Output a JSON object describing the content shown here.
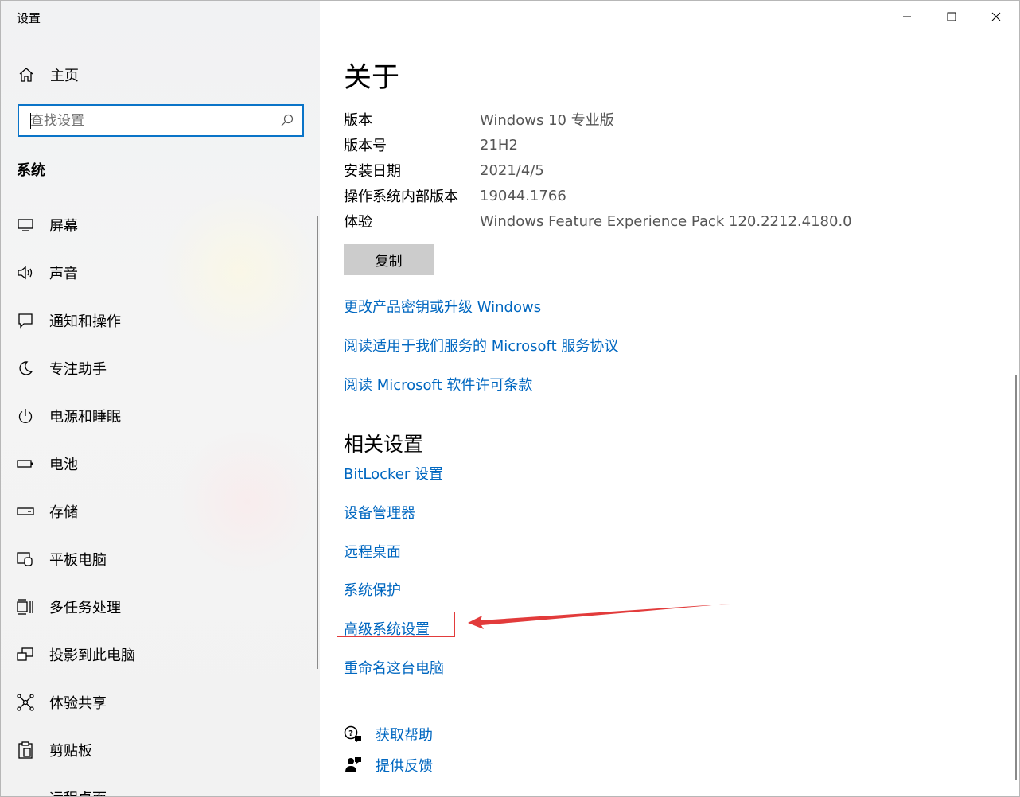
{
  "window": {
    "title": "设置"
  },
  "sidebar": {
    "home_label": "主页",
    "search_placeholder": "查找设置",
    "section_title": "系统",
    "items": [
      {
        "label": "屏幕",
        "icon": "monitor-icon"
      },
      {
        "label": "声音",
        "icon": "speaker-icon"
      },
      {
        "label": "通知和操作",
        "icon": "notification-icon"
      },
      {
        "label": "专注助手",
        "icon": "moon-icon"
      },
      {
        "label": "电源和睡眠",
        "icon": "power-icon"
      },
      {
        "label": "电池",
        "icon": "battery-icon"
      },
      {
        "label": "存储",
        "icon": "storage-icon"
      },
      {
        "label": "平板电脑",
        "icon": "tablet-icon"
      },
      {
        "label": "多任务处理",
        "icon": "multitask-icon"
      },
      {
        "label": "投影到此电脑",
        "icon": "project-icon"
      },
      {
        "label": "体验共享",
        "icon": "share-icon"
      },
      {
        "label": "剪贴板",
        "icon": "clipboard-icon"
      },
      {
        "label": "远程桌面",
        "icon": "remote-icon"
      }
    ]
  },
  "main": {
    "title": "关于",
    "specs": [
      {
        "key": "版本",
        "value": "Windows 10 专业版"
      },
      {
        "key": "版本号",
        "value": "21H2"
      },
      {
        "key": "安装日期",
        "value": "2021/4/5"
      },
      {
        "key": "操作系统内部版本",
        "value": "19044.1766"
      },
      {
        "key": "体验",
        "value": "Windows Feature Experience Pack 120.2212.4180.0"
      }
    ],
    "copy_label": "复制",
    "links": [
      "更改产品密钥或升级 Windows",
      "阅读适用于我们服务的 Microsoft 服务协议",
      "阅读 Microsoft 软件许可条款"
    ],
    "related_title": "相关设置",
    "related_links": [
      "BitLocker 设置",
      "设备管理器",
      "远程桌面",
      "系统保护",
      "高级系统设置",
      "重命名这台电脑"
    ],
    "help": {
      "get_help": "获取帮助",
      "feedback": "提供反馈"
    }
  },
  "colors": {
    "accent": "#0067c0",
    "search_border": "#0a74c8",
    "annotation": "#e23b3b"
  }
}
